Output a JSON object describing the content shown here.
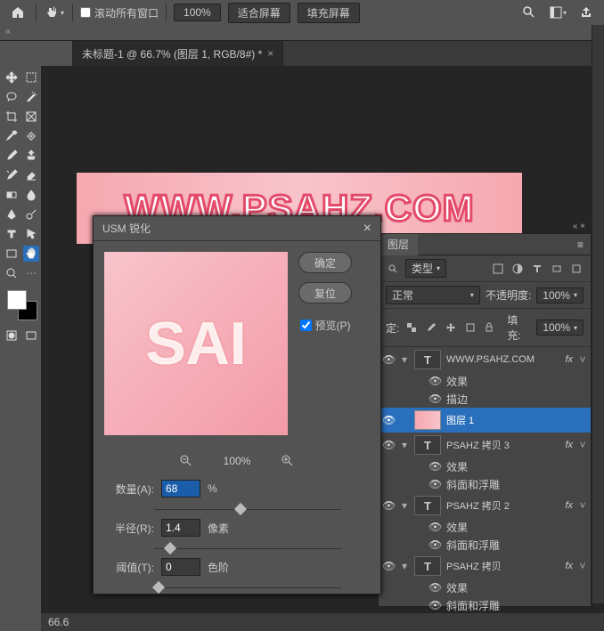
{
  "topbar": {
    "scroll_all_windows": "滚动所有窗口",
    "zoom": "100%",
    "fit_screen": "适合屏幕",
    "fill_screen": "填充屏幕"
  },
  "doc": {
    "tab_title": "未标题-1 @ 66.7% (图层 1, RGB/8#) *",
    "status_zoom": "66.6"
  },
  "canvas": {
    "text": "WWW.PSAHZ.COM"
  },
  "dialog": {
    "title": "USM 锐化",
    "ok": "确定",
    "reset": "复位",
    "preview_label": "预览(P)",
    "preview_checked": true,
    "zoom_percent": "100%",
    "amount_label": "数量(A):",
    "amount_value": "68",
    "amount_unit": "%",
    "radius_label": "半径(R):",
    "radius_value": "1.4",
    "radius_unit": "像素",
    "threshold_label": "阈值(T):",
    "threshold_value": "0",
    "threshold_unit": "色阶"
  },
  "layers_panel": {
    "tab": "图层",
    "type_label": "类型",
    "blend_mode": "正常",
    "opacity_label": "不透明度:",
    "opacity_value": "100%",
    "lock_label": "定:",
    "fill_label": "填充:",
    "fill_value": "100%",
    "items": [
      {
        "name": "WWW.PSAHZ.COM",
        "type": "text",
        "fx": true,
        "expanded": true,
        "effects": [
          "效果",
          "描边"
        ]
      },
      {
        "name": "图层 1",
        "type": "raster",
        "selected": true,
        "fx": false
      },
      {
        "name": "PSAHZ 拷贝 3",
        "type": "text",
        "fx": true,
        "expanded": true,
        "effects": [
          "效果",
          "斜面和浮雕"
        ]
      },
      {
        "name": "PSAHZ 拷贝 2",
        "type": "text",
        "fx": true,
        "expanded": true,
        "effects": [
          "效果",
          "斜面和浮雕"
        ]
      },
      {
        "name": "PSAHZ 拷贝",
        "type": "text",
        "fx": true,
        "expanded": true,
        "effects": [
          "效果",
          "斜面和浮雕"
        ]
      }
    ]
  }
}
